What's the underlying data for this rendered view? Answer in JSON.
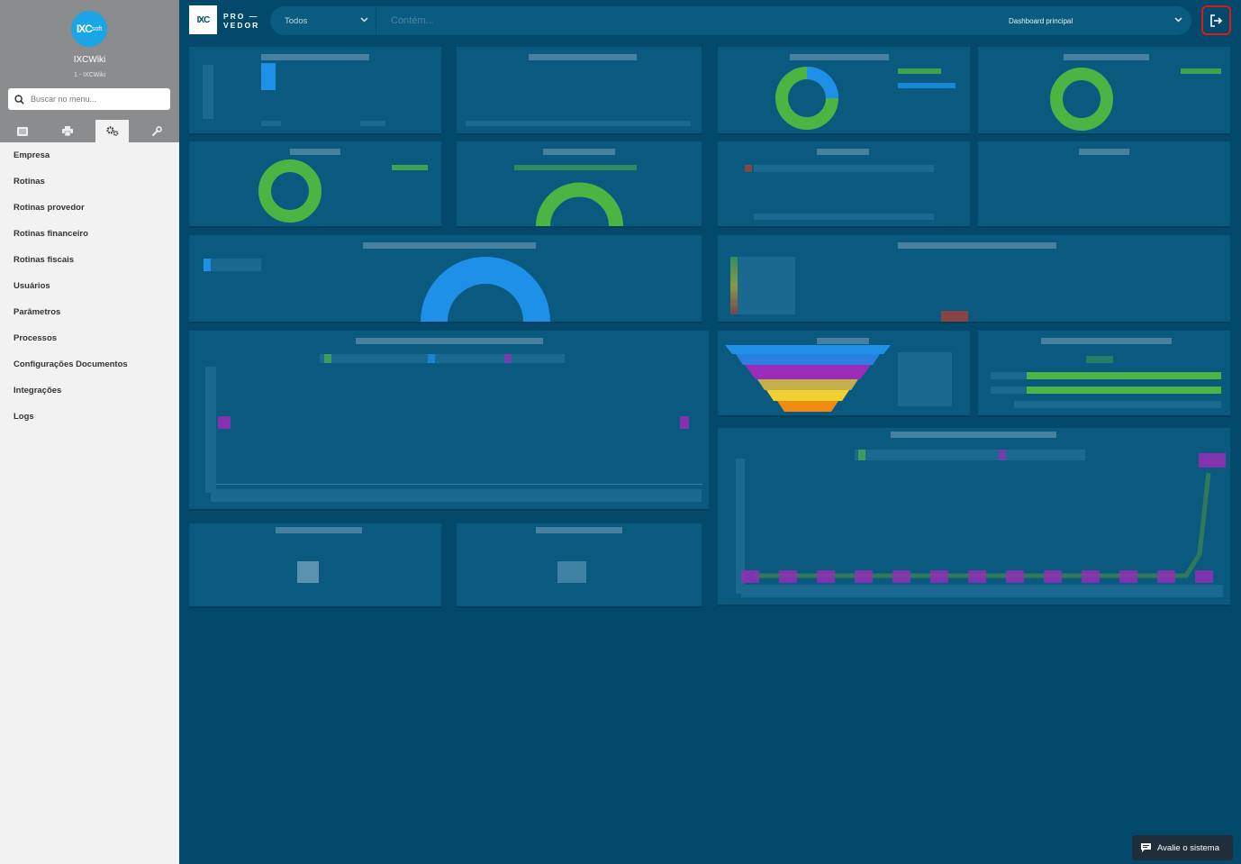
{
  "sidebar": {
    "logo_text": "IXC",
    "logo_sub": "soft",
    "org_name": "IXCWiki",
    "org_sub": "1 - IXCWiki",
    "search_placeholder": "Buscar no menu...",
    "tabs": [
      "list-icon",
      "print-icon",
      "cogs-icon",
      "wrench-icon"
    ],
    "menu": [
      "Empresa",
      "Rotinas",
      "Rotinas provedor",
      "Rotinas financeiro",
      "Rotinas fiscais",
      "Usuários",
      "Parâmetros",
      "Processos",
      "Configurações Documentos",
      "Integrações",
      "Logs"
    ]
  },
  "topbar": {
    "brand_box": "IXC",
    "brand_line1": "PRO —",
    "brand_line2": "VEDOR",
    "search_scope": "Todos",
    "search_placeholder": "Contém...",
    "dashboard_select": "Dashboard principal"
  },
  "footer": {
    "rate_label": "Avalie o sistema"
  },
  "colors": {
    "background": "#02496b",
    "widget": "#0a5a80",
    "accent_green": "#4bb543",
    "accent_blue": "#1e90e8",
    "accent_purple": "#9b2bb8",
    "logout_border": "#e01818"
  }
}
